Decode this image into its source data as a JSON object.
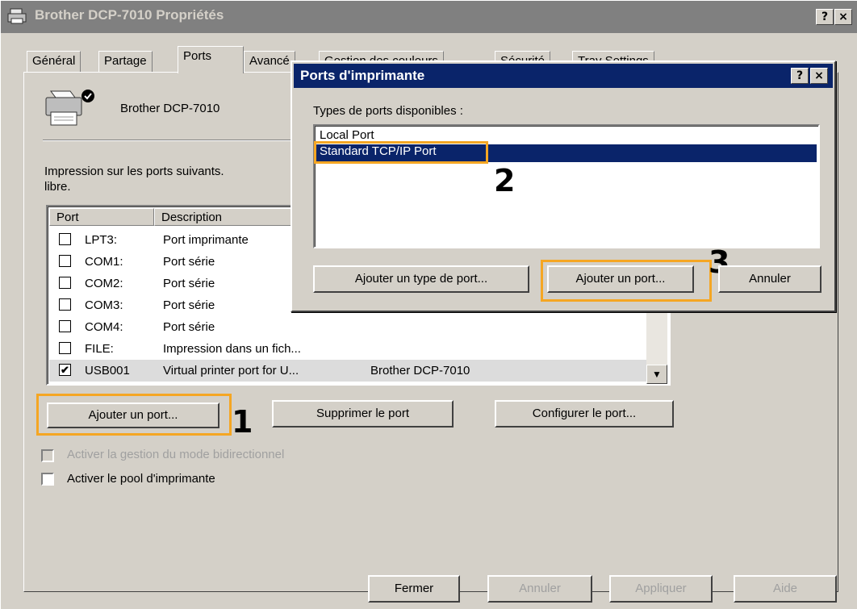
{
  "window": {
    "title": "Brother DCP-7010 Propriétés",
    "help_button": "?",
    "close_button": "×"
  },
  "tabs": [
    {
      "label": "Général"
    },
    {
      "label": "Partage"
    },
    {
      "label": "Ports",
      "active": true
    },
    {
      "label": "Avancé"
    },
    {
      "label": "Gestion des couleurs"
    },
    {
      "label": "Sécurité"
    },
    {
      "label": "Tray Settings"
    }
  ],
  "printer": {
    "name": "Brother DCP-7010",
    "icon": "printer-icon"
  },
  "ports_section": {
    "description": "Impression sur les ports suivants.",
    "description_line2": "libre."
  },
  "port_list": {
    "headers": [
      "Port",
      "Description"
    ],
    "rows": [
      {
        "port": "LPT3:",
        "description": "Port imprimante",
        "printer": "",
        "checked": false
      },
      {
        "port": "COM1:",
        "description": "Port série",
        "printer": "",
        "checked": false
      },
      {
        "port": "COM2:",
        "description": "Port série",
        "printer": "",
        "checked": false
      },
      {
        "port": "COM3:",
        "description": "Port série",
        "printer": "",
        "checked": false
      },
      {
        "port": "COM4:",
        "description": "Port série",
        "printer": "",
        "checked": false
      },
      {
        "port": "FILE:",
        "description": "Impression dans un fich...",
        "printer": "",
        "checked": false
      },
      {
        "port": "USB001",
        "description": "Virtual printer port for U...",
        "printer": "Brother DCP-7010",
        "checked": true
      }
    ]
  },
  "port_buttons": {
    "add": "Ajouter un port...",
    "delete": "Supprimer le port",
    "configure": "Configurer le port..."
  },
  "options": {
    "bidirectional": "Activer la gestion du mode bidirectionnel",
    "pool": "Activer le pool d'imprimante"
  },
  "footer_buttons": {
    "close": "Fermer",
    "cancel": "Annuler",
    "apply": "Appliquer",
    "help": "Aide"
  },
  "dialog": {
    "title": "Ports d'imprimante",
    "help_button": "?",
    "close_button": "×",
    "list_label": "Types de ports disponibles :",
    "port_types": [
      {
        "label": "Local Port",
        "selected": false
      },
      {
        "label": "Standard TCP/IP Port",
        "selected": true
      }
    ],
    "buttons": {
      "add_type": "Ajouter un type de port...",
      "add_port": "Ajouter un port...",
      "cancel": "Annuler"
    }
  },
  "annotations": {
    "step1": "1",
    "step2": "2",
    "step3": "3",
    "highlight_color": "#f5a623"
  }
}
